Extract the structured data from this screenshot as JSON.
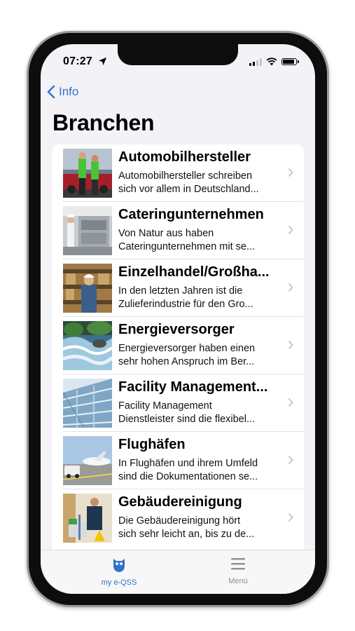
{
  "status": {
    "time": "07:27"
  },
  "nav": {
    "back_label": "Info",
    "title": "Branchen"
  },
  "rows": [
    {
      "title": "Automobilhersteller",
      "line1": "Automobilhersteller schreiben",
      "line2": "sich vor allem in Deutschland..."
    },
    {
      "title": "Cateringunternehmen",
      "line1": "Von Natur aus haben",
      "line2": "Cateringunternehmen mit se..."
    },
    {
      "title": "Einzelhandel/Großha...",
      "line1": "In den letzten Jahren ist die",
      "line2": "Zulieferindustrie für den Gro..."
    },
    {
      "title": "Energieversorger",
      "line1": "Energieversorger haben einen",
      "line2": "sehr hohen Anspruch im Ber..."
    },
    {
      "title": "Facility Management...",
      "line1": "Facility Management",
      "line2": "Dienstleister sind die flexibel..."
    },
    {
      "title": "Flughäfen",
      "line1": "In Flughäfen und ihrem Umfeld",
      "line2": "sind die Dokumentationen se..."
    },
    {
      "title": "Gebäudereinigung",
      "line1": "Die Gebäudereinigung hört",
      "line2": "sich sehr leicht an, bis zu de..."
    }
  ],
  "tabbar": {
    "tab1": {
      "label": "my e-QSS",
      "icon": "owl-icon"
    },
    "tab2": {
      "label": "Menü",
      "icon": "menu-icon"
    }
  },
  "colors": {
    "accent": "#2f73c7",
    "inactive": "#8e8e93"
  }
}
